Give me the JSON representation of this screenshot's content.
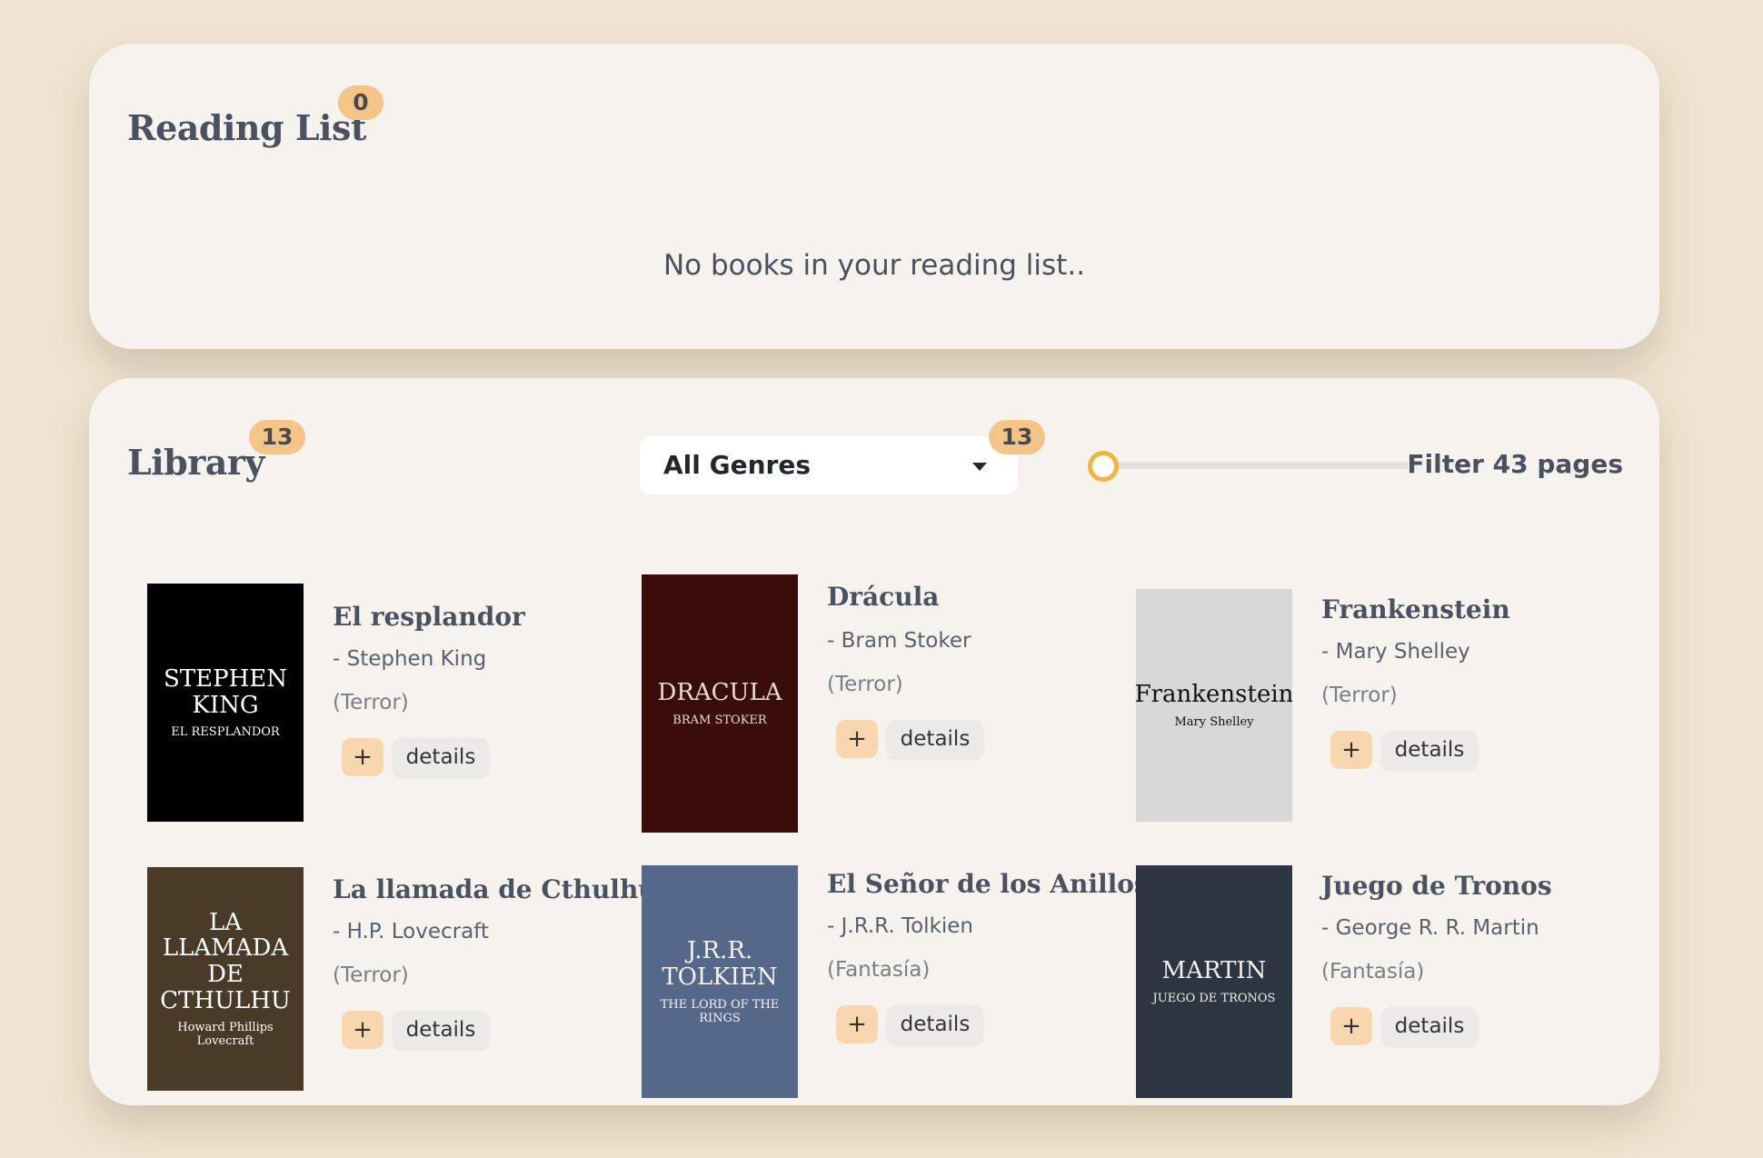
{
  "reading_list": {
    "title": "Reading List",
    "count": "0",
    "empty_message": "No books in your reading list.."
  },
  "library": {
    "title": "Library",
    "count": "13",
    "genre_select": {
      "value": "All Genres",
      "count": "13"
    },
    "page_filter": {
      "label": "Filter 43 pages",
      "value": 43,
      "level": 0.0
    },
    "books": [
      {
        "title": "El resplandor",
        "author": "- Stephen King",
        "genre": "(Terror)",
        "add_label": "+",
        "details_label": "details",
        "cover": {
          "title": "STEPHEN KING",
          "subtitle": "EL RESPLANDOR",
          "bg": "#000000",
          "fg": "#ffffff"
        }
      },
      {
        "title": "Drácula",
        "author": "- Bram Stoker",
        "genre": "(Terror)",
        "add_label": "+",
        "details_label": "details",
        "cover": {
          "title": "DRACULA",
          "subtitle": "BRAM STOKER",
          "bg": "#3a0c0c",
          "fg": "#e8dcd0"
        }
      },
      {
        "title": "Frankenstein",
        "author": "- Mary Shelley",
        "genre": "(Terror)",
        "add_label": "+",
        "details_label": "details",
        "cover": {
          "title": "Frankenstein",
          "subtitle": "Mary Shelley",
          "bg": "#d8d8d8",
          "fg": "#111111"
        }
      },
      {
        "title": "La llamada de Cthulhu",
        "author": "- H.P. Lovecraft",
        "genre": "(Terror)",
        "add_label": "+",
        "details_label": "details",
        "cover": {
          "title": "LA LLAMADA DE CTHULHU",
          "subtitle": "Howard Phillips Lovecraft",
          "bg": "#4a3a28",
          "fg": "#ffffff"
        }
      },
      {
        "title": "El Señor de los Anillos",
        "author": "- J.R.R. Tolkien",
        "genre": "(Fantasía)",
        "add_label": "+",
        "details_label": "details",
        "cover": {
          "title": "J.R.R. TOLKIEN",
          "subtitle": "THE LORD OF THE RINGS",
          "bg": "#56688a",
          "fg": "#f2f2f2"
        }
      },
      {
        "title": "Juego de Tronos",
        "author": "- George R. R. Martin",
        "genre": "(Fantasía)",
        "add_label": "+",
        "details_label": "details",
        "cover": {
          "title": "MARTIN",
          "subtitle": "JUEGO DE TRONOS",
          "bg": "#2c3540",
          "fg": "#f0f0f0"
        }
      }
    ]
  }
}
